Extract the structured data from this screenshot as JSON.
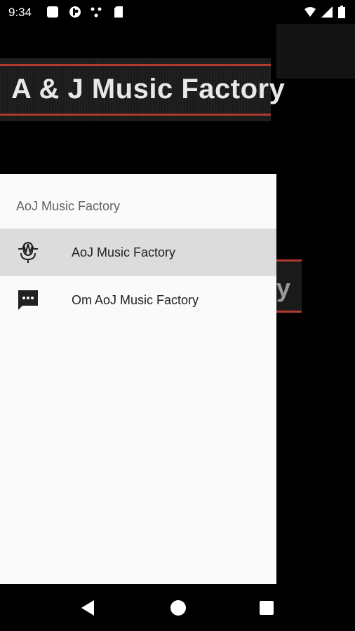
{
  "status_bar": {
    "time": "9:34",
    "left_icons": [
      "square-notification-icon",
      "media-notification-icon",
      "share-notification-icon",
      "sd-card-icon"
    ],
    "right_icons": [
      "wifi-icon",
      "signal-icon",
      "battery-icon"
    ]
  },
  "banner": {
    "title": "A & J Music Factory"
  },
  "background": {
    "banner_fragment_text": "y"
  },
  "drawer": {
    "header": "AoJ Music Factory",
    "items": [
      {
        "label": "AoJ Music Factory",
        "icon": "microphone-icon",
        "selected": true
      },
      {
        "label": "Om AoJ Music Factory",
        "icon": "chat-icon",
        "selected": false
      }
    ]
  },
  "nav_bar": {
    "buttons": [
      "back-button",
      "home-button",
      "recents-button"
    ]
  },
  "colors": {
    "banner_accent": "#b03a2e",
    "drawer_bg": "#fafafa",
    "selected_item_bg": "#dcdcdc"
  }
}
